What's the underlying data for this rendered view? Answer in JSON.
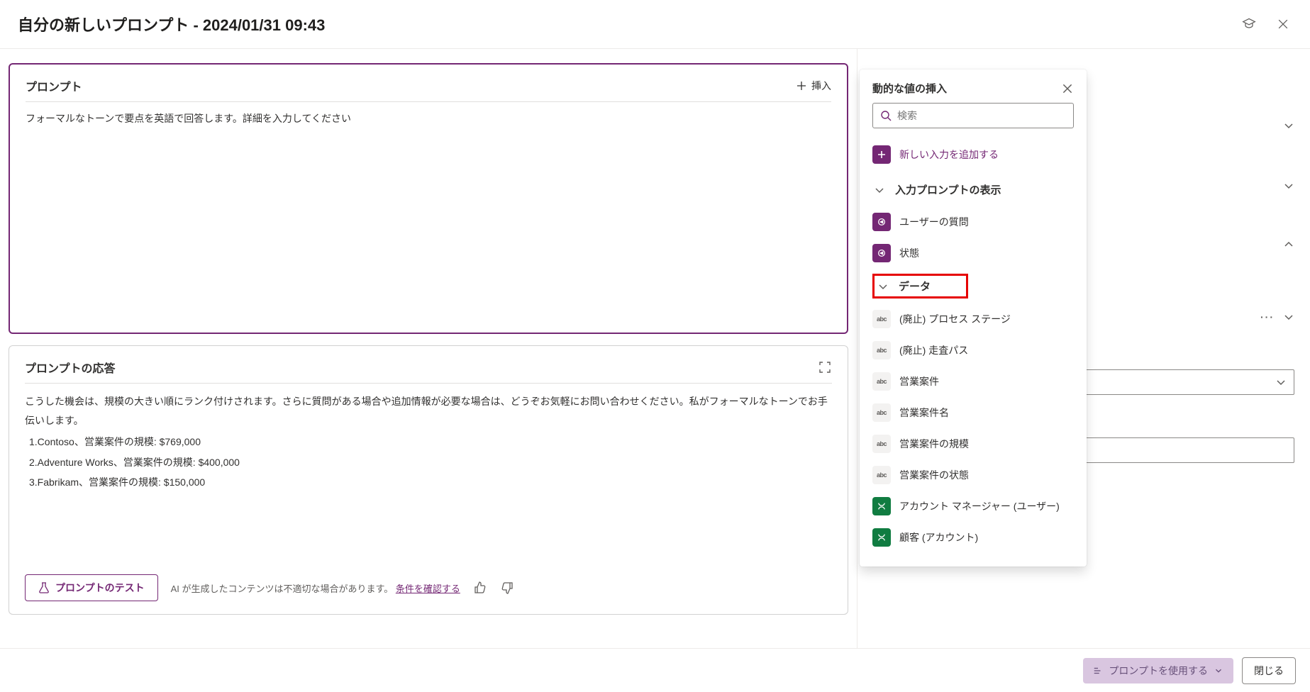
{
  "header": {
    "title": "自分の新しいプロンプト - 2024/01/31 09:43"
  },
  "prompt_card": {
    "title": "プロンプト",
    "insert_label": "挿入",
    "body": "フォーマルなトーンで要点を英語で回答します。詳細を入力してください"
  },
  "response_card": {
    "title": "プロンプトの応答",
    "intro": "こうした機会は、規模の大きい順にランク付けされます。さらに質問がある場合や追加情報が必要な場合は、どうぞお気軽にお問い合わせください。私がフォーマルなトーンでお手伝いします。",
    "items": [
      "1.Contoso、営業案件の規模: $769,000",
      "2.Adventure Works、営業案件の規模: $400,000",
      "3.Fabrikam、営業案件の規模: $150,000"
    ],
    "test_button": "プロンプトのテスト",
    "disclaimer_text": "AI が生成したコンテンツは不適切な場合があります。",
    "disclaimer_link": "条件を確認する"
  },
  "flyout": {
    "title": "動的な値の挿入",
    "search_placeholder": "検索",
    "add_input_label": "新しい入力を追加する",
    "section_inputs": "入力プロンプトの表示",
    "section_data": "データ",
    "input_items": [
      {
        "icon": "purple",
        "label": "ユーザーの質問"
      },
      {
        "icon": "purple",
        "label": "状態"
      }
    ],
    "data_items": [
      {
        "icon": "abc",
        "label": "(廃止) プロセス ステージ"
      },
      {
        "icon": "abc",
        "label": "(廃止) 走査パス"
      },
      {
        "icon": "abc",
        "label": "営業案件"
      },
      {
        "icon": "abc",
        "label": "営業案件名"
      },
      {
        "icon": "abc",
        "label": "営業案件の規模"
      },
      {
        "icon": "abc",
        "label": "営業案件の状態"
      },
      {
        "icon": "green",
        "label": "アカウント マネージャー (ユーザー)"
      },
      {
        "icon": "green",
        "label": "顧客 (アカウント)"
      }
    ]
  },
  "footer": {
    "use_prompt": "プロンプトを使用する",
    "close": "閉じる"
  }
}
